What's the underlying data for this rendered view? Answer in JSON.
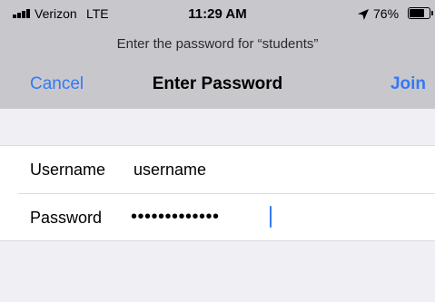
{
  "status_bar": {
    "carrier": "Verizon",
    "network": "LTE",
    "time": "11:29 AM",
    "location_icon": "location-arrow",
    "battery_percent": "76%",
    "battery_level": 0.76,
    "signal_bars": 4
  },
  "dialog": {
    "prompt": "Enter the password for “students”",
    "cancel_label": "Cancel",
    "title": "Enter Password",
    "join_label": "Join"
  },
  "form": {
    "username": {
      "label": "Username",
      "value": "username"
    },
    "password": {
      "label": "Password",
      "value": "•••••••••••••"
    }
  },
  "colors": {
    "accent": "#3478f6",
    "header_bg": "#c8c8cc",
    "page_bg": "#efeff4"
  }
}
